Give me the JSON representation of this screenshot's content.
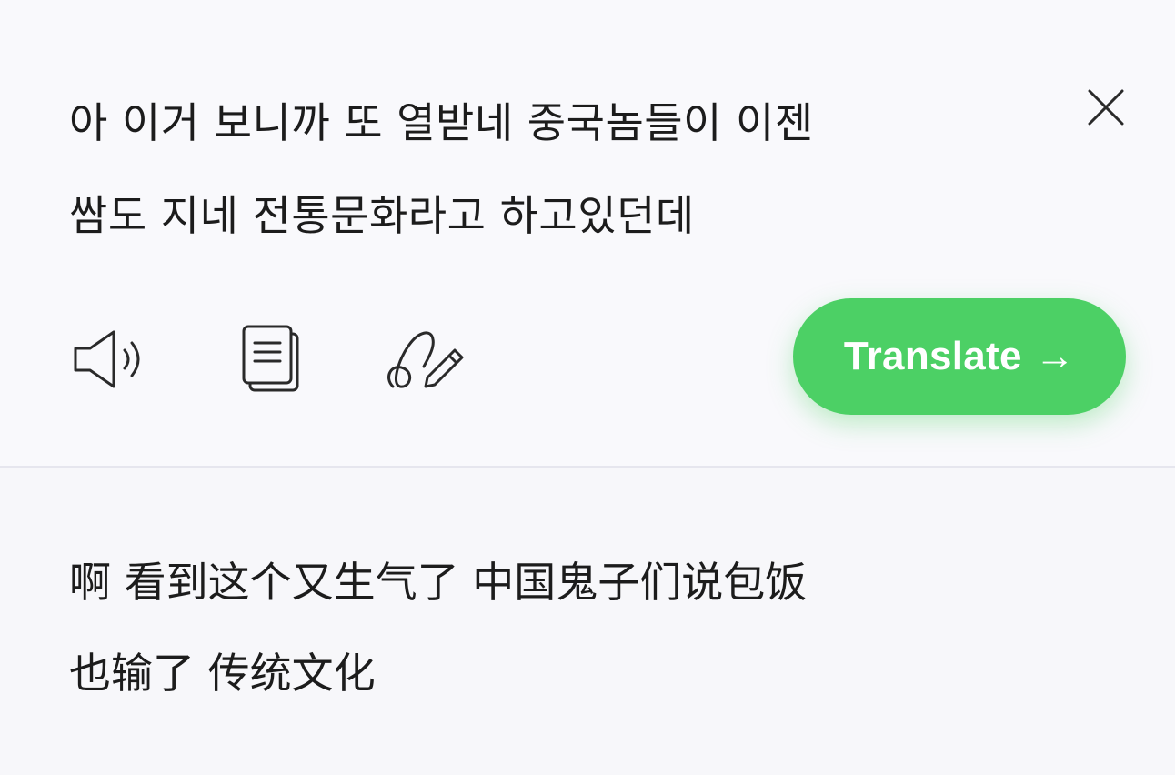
{
  "source": {
    "text": "아 이거 보니까 또 열받네 중국놈들이 이젠\n쌈도 지네 전통문화라고 하고있던데"
  },
  "toolbar": {
    "speak_icon": "speaker-icon",
    "copy_icon": "copy-icon",
    "handwrite_icon": "handwriting-icon",
    "translate_label": "Translate",
    "translate_arrow": "→"
  },
  "result": {
    "text": "啊 看到这个又生气了 中国鬼子们说包饭\n也输了 传统文化"
  },
  "colors": {
    "accent": "#4cd065",
    "text": "#1c1c1c",
    "icon": "#2a2a2a",
    "divider": "#e6e6ee"
  }
}
